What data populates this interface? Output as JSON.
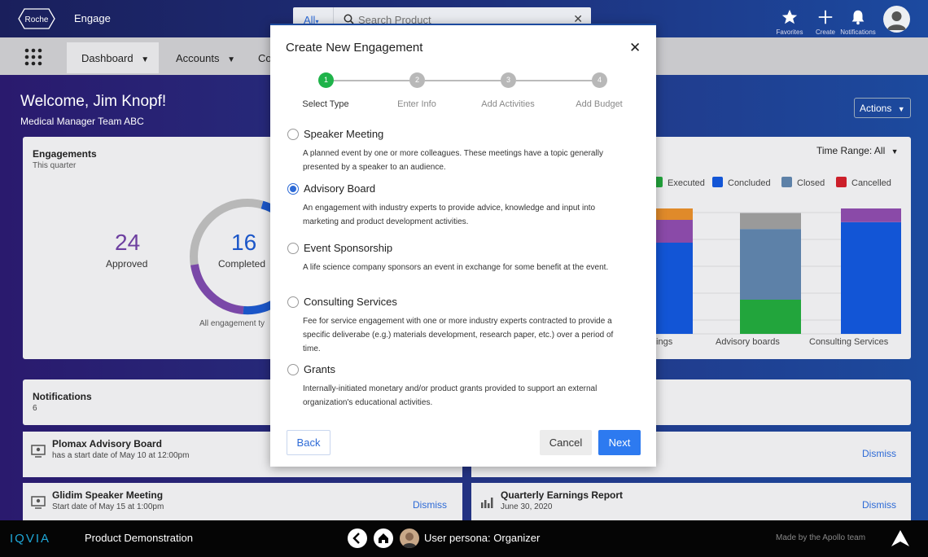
{
  "header": {
    "logo_text": "Roche",
    "app_name": "Engage",
    "search": {
      "scope": "All",
      "placeholder": "Search Product"
    },
    "actions": [
      {
        "label": "Favorites",
        "icon": "star-icon"
      },
      {
        "label": "Create",
        "icon": "plus-icon"
      },
      {
        "label": "Notifications",
        "icon": "bell-icon"
      }
    ]
  },
  "nav": {
    "tabs": [
      {
        "label": "Dashboard"
      },
      {
        "label": "Accounts"
      },
      {
        "label": "Co"
      }
    ]
  },
  "dashboard": {
    "welcome": "Welcome, Jim Knopf!",
    "team": "Medical Manager Team ABC",
    "actions_label": "Actions",
    "engagements": {
      "title": "Engagements",
      "subtitle": "This quarter",
      "approved_value": "24",
      "approved_label": "Approved",
      "completed_value": "16",
      "completed_label": "Completed",
      "all_types": "All engagement ty",
      "time_range": "Time Range: All",
      "legend": [
        {
          "label": "Executed",
          "color": "#22a53c"
        },
        {
          "label": "Concluded",
          "color": "#1255d6"
        },
        {
          "label": "Closed",
          "color": "#5d81a8"
        },
        {
          "label": "Cancelled",
          "color": "#cc1f2a"
        }
      ],
      "categories": [
        "tings",
        "Advisory boards",
        "Consulting Services"
      ]
    },
    "notifications": {
      "title": "Notifications",
      "count": "6",
      "dismiss_label": "Dismiss",
      "items": [
        {
          "title": "Plomax Advisory Board",
          "subtitle": "has a start date of May 10 at 12:00pm"
        },
        {
          "title": "Glidim Speaker Meeting",
          "subtitle": "Start date of May 15 at 1:00pm"
        },
        {
          "title": "Quarterly Earnings Report",
          "subtitle": "June 30, 2020"
        }
      ]
    }
  },
  "modal": {
    "title": "Create New Engagement",
    "steps": [
      {
        "number": "1",
        "label": "Select Type"
      },
      {
        "number": "2",
        "label": "Enter Info"
      },
      {
        "number": "3",
        "label": "Add Activities"
      },
      {
        "number": "4",
        "label": "Add Budget"
      }
    ],
    "options": [
      {
        "title": "Speaker Meeting",
        "description": "A planned event by one or more colleagues. These meetings have a topic generally presented by a speaker to an audience."
      },
      {
        "title": "Advisory Board",
        "description": "An engagement with industry experts to provide advice, knowledge and input into marketing and product development activities."
      },
      {
        "title": "Event Sponsorship",
        "description": "A life science company sponsors an event in exchange for some benefit at the event."
      },
      {
        "title": "Consulting Services",
        "description": "Fee for service engagement with one or more industry experts contracted to provide a specific deliverabe (e.g.) materials development, research paper, etc.) over a period of time."
      },
      {
        "title": "Grants",
        "description": "Internally-initiated monetary and/or product grants provided to support an external organization's educational activities."
      }
    ],
    "selected_option": "Advisory Board",
    "back_label": "Back",
    "cancel_label": "Cancel",
    "next_label": "Next"
  },
  "footer": {
    "brand": "IQVIA",
    "product_demo": "Product Demonstration",
    "persona": "User persona: Organizer",
    "made_by": "Made by the Apollo team"
  },
  "chart_data": {
    "type": "bar",
    "categories": [
      "tings",
      "Advisory boards",
      "Consulting Services"
    ],
    "series": [
      {
        "name": "Executed",
        "values": [
          0,
          1.5,
          0
        ]
      },
      {
        "name": "Concluded",
        "values": [
          4,
          0,
          4.9
        ]
      },
      {
        "name": "Closed",
        "values": [
          0,
          3.1,
          0
        ]
      }
    ],
    "extra_segments_colors": [
      "#e08a2a",
      "#8a4aa8",
      "#9a9a9a"
    ]
  }
}
